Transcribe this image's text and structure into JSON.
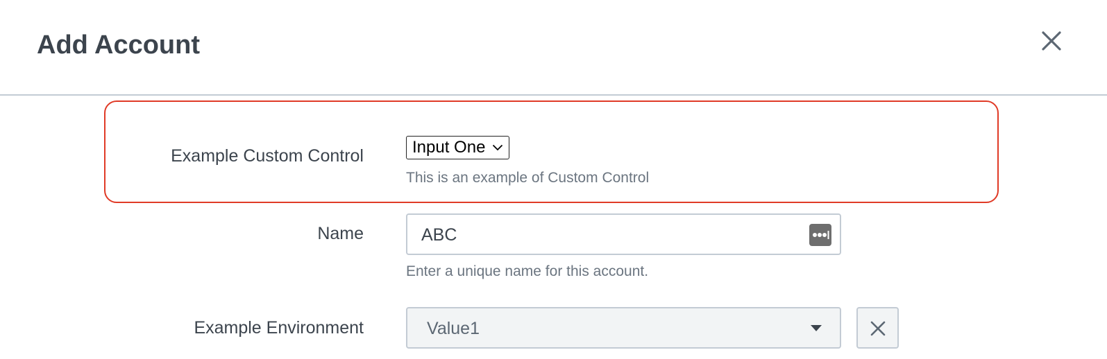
{
  "dialog": {
    "title": "Add Account",
    "close_icon": "close-icon"
  },
  "fields": {
    "custom_control": {
      "label": "Example Custom Control",
      "selected": "Input One",
      "help": "This is an example of Custom Control"
    },
    "name": {
      "label": "Name",
      "value": "ABC",
      "help": "Enter a unique name for this account.",
      "icon": "password-manager-icon"
    },
    "environment": {
      "label": "Example Environment",
      "value": "Value1",
      "caret_icon": "caret-down-icon",
      "clear_icon": "close-icon"
    }
  },
  "colors": {
    "highlight_border": "#e03a26",
    "text": "#3c444d",
    "help_text": "#6b7580",
    "input_border": "#c3cbd4",
    "dropdown_bg": "#f2f4f5"
  }
}
